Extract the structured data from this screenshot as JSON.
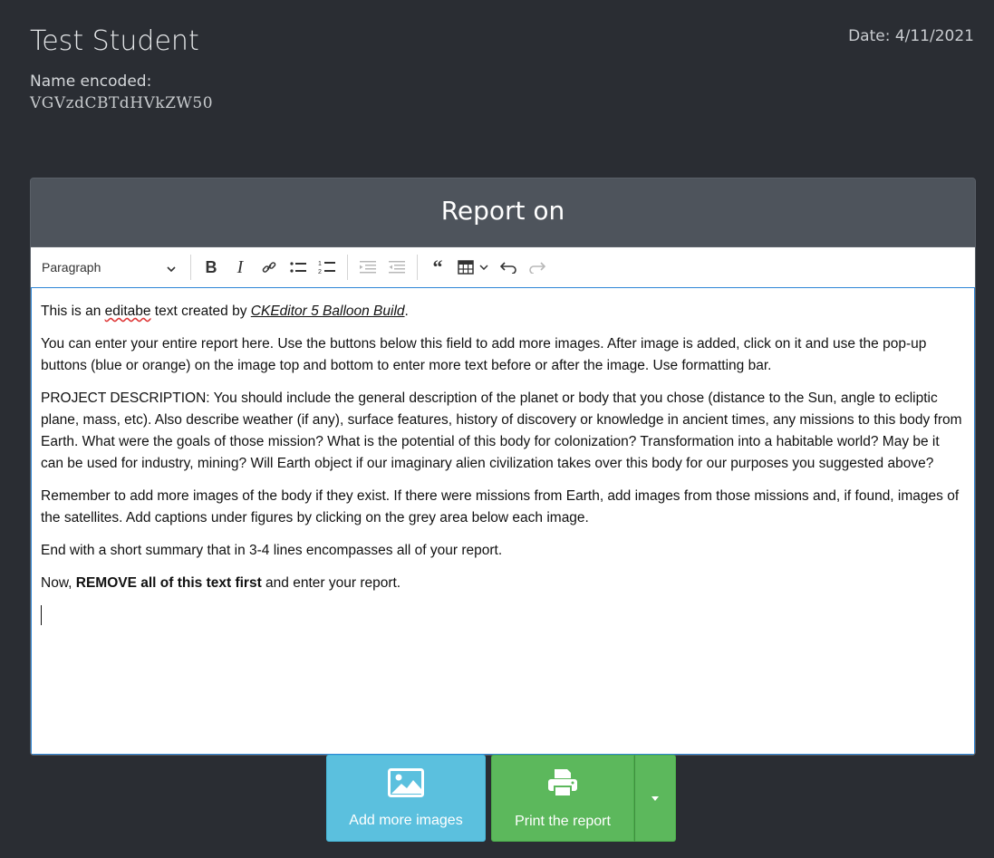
{
  "header": {
    "student_name": "Test Student",
    "encoded_label": "Name encoded:",
    "encoded_value": "VGVzdCBTdHVkZW50",
    "date": "Date: 4/11/2021"
  },
  "report": {
    "title": "Report on",
    "toolbar": {
      "heading_select": "Paragraph",
      "icons": [
        "bold-icon",
        "italic-icon",
        "link-icon",
        "bulleted-list-icon",
        "numbered-list-icon",
        "outdent-icon",
        "indent-icon",
        "blockquote-icon",
        "table-icon",
        "undo-icon",
        "redo-icon"
      ]
    },
    "paragraphs": {
      "p1_a": "This is an ",
      "p1_wavy": "editabe",
      "p1_b": " text created by ",
      "p1_link": "CKEditor 5 Balloon Build",
      "p1_c": ".",
      "p2": "You can enter your entire report here. Use the buttons below this field to add more images. After image is added, click on it and use the pop-up buttons (blue or orange) on the image top and bottom to enter more text before or after the image. Use formatting bar.",
      "p3": "PROJECT DESCRIPTION: You should include the general description of the planet or body that you chose (distance to the Sun, angle to ecliptic plane, mass, etc). Also describe weather (if any), surface features, history of discovery or knowledge in ancient times, any missions to this body from Earth. What were the goals of those mission? What is the potential of this body for colonization? Transformation into a habitable world? May be it can be used for industry, mining? Will Earth object if our imaginary alien civilization takes over this body for our purposes you suggested above?",
      "p4": "Remember to add more images of the body if they exist. If there were missions from Earth, add images from those missions and, if found, images of the satellites. Add captions under figures by clicking on the grey area below each image.",
      "p5": "End with a short summary that in 3-4 lines encompasses all of your report.",
      "p6_a": "Now, ",
      "p6_bold": "REMOVE all of this text first",
      "p6_b": " and enter your report."
    }
  },
  "actions": {
    "add_images_label": "Add more images",
    "print_label": "Print the report",
    "colors": {
      "info": "#5bc0de",
      "success": "#5cb85c"
    }
  }
}
